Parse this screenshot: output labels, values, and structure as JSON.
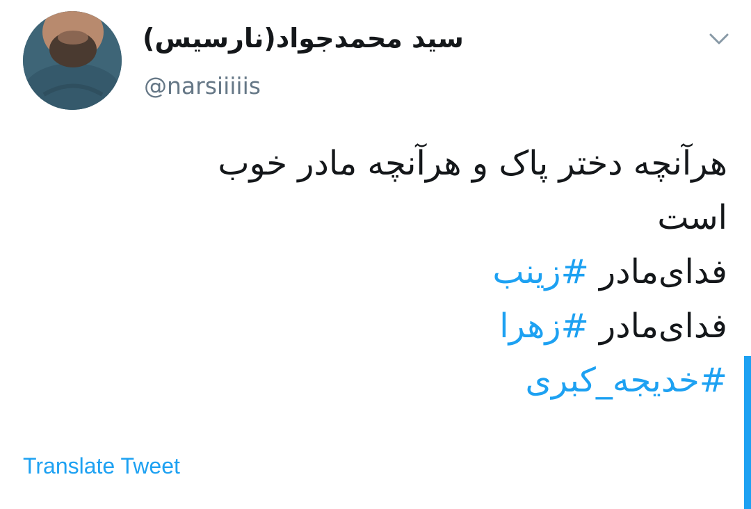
{
  "tweet": {
    "display_name": "سید محمدجواد(نارسیس)",
    "handle": "@narsiiiiis",
    "body_line_1": "هرآنچه دختر پاک و هرآنچه مادر خوب",
    "body_line_2": "است",
    "line_3_text": "فدای‌مادر ",
    "line_3_hashtag": "#زینب",
    "line_4_text": "فدای‌مادر ",
    "line_4_hashtag": "#زهرا",
    "line_5_hashtag": "#خدیجه_کبری",
    "translate_label": "Translate Tweet"
  },
  "icons": {
    "caret": "chevron-down-icon",
    "avatar": "avatar"
  },
  "colors": {
    "link": "#1da1f2",
    "text": "#14171a",
    "secondary": "#657786"
  }
}
